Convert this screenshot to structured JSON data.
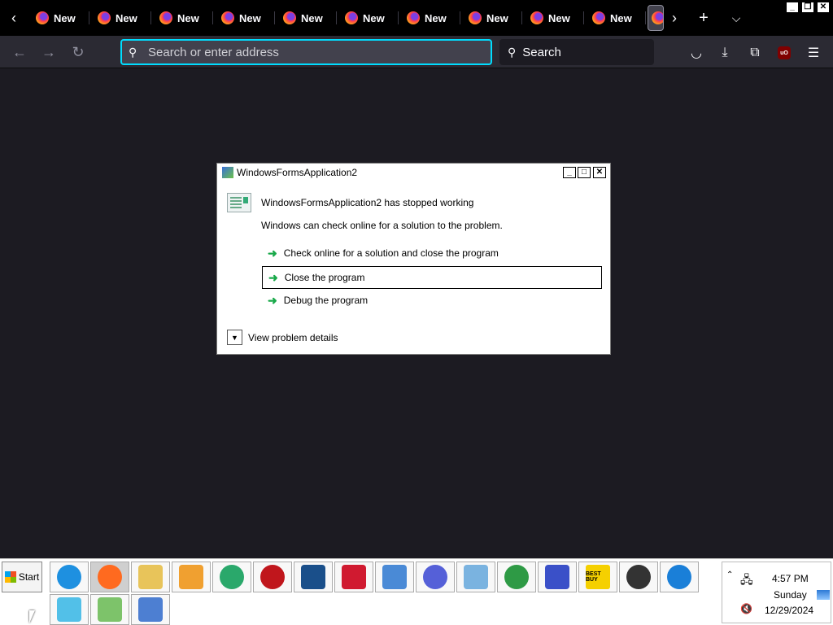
{
  "browser": {
    "tabs": [
      {
        "label": "New"
      },
      {
        "label": "New"
      },
      {
        "label": "New"
      },
      {
        "label": "New"
      },
      {
        "label": "New"
      },
      {
        "label": "New"
      },
      {
        "label": "New"
      },
      {
        "label": "New"
      },
      {
        "label": "New"
      },
      {
        "label": "New"
      }
    ],
    "urlbar": {
      "placeholder": "Search or enter address"
    },
    "searchbar": {
      "label": "Search"
    },
    "ublock_label": "uO"
  },
  "dialog": {
    "title": "WindowsFormsApplication2",
    "heading": "WindowsFormsApplication2 has stopped working",
    "message": "Windows can check online for a solution to the problem.",
    "options": [
      {
        "label": "Check online for a solution and close the program"
      },
      {
        "label": "Close the program"
      },
      {
        "label": "Debug the program"
      }
    ],
    "details_label": "View problem details"
  },
  "taskbar": {
    "start_label": "Start",
    "apps": [
      {
        "icon": "internet-explorer-icon",
        "color": "#1e90e0"
      },
      {
        "icon": "firefox-icon",
        "color": "#ff6a1f"
      },
      {
        "icon": "file-explorer-icon",
        "color": "#e8c45a"
      },
      {
        "icon": "media-player-icon",
        "color": "#f0a030"
      },
      {
        "icon": "edge-icon",
        "color": "#2aa86b"
      },
      {
        "icon": "security-app-icon",
        "color": "#c0161c"
      },
      {
        "icon": "shield-app-icon",
        "color": "#1a4f8a"
      },
      {
        "icon": "video-editor-icon",
        "color": "#d01a30"
      },
      {
        "icon": "control-panel-icon",
        "color": "#4a8ad6"
      },
      {
        "icon": "bird-app-icon",
        "color": "#5560d8"
      },
      {
        "icon": "paint-icon",
        "color": "#7ab3e0"
      },
      {
        "icon": "chrome-icon",
        "color": "#2e9a45"
      },
      {
        "icon": "infinity-app-icon",
        "color": "#3a50c8"
      },
      {
        "icon": "best-buy-icon",
        "color": "#f5d000"
      },
      {
        "icon": "berry-app-icon",
        "color": "#333333"
      },
      {
        "icon": "ie-blue-icon",
        "color": "#1a7fd8"
      },
      {
        "icon": "recycle-bin-icon",
        "color": "#52c0e8"
      },
      {
        "icon": "package-icon",
        "color": "#7dc36a"
      },
      {
        "icon": "app-window-icon",
        "color": "#4d7fd2"
      }
    ],
    "best_buy_label": "BEST BUY",
    "clock": {
      "time": "4:57 PM",
      "day": "Sunday",
      "date": "12/29/2024"
    }
  }
}
